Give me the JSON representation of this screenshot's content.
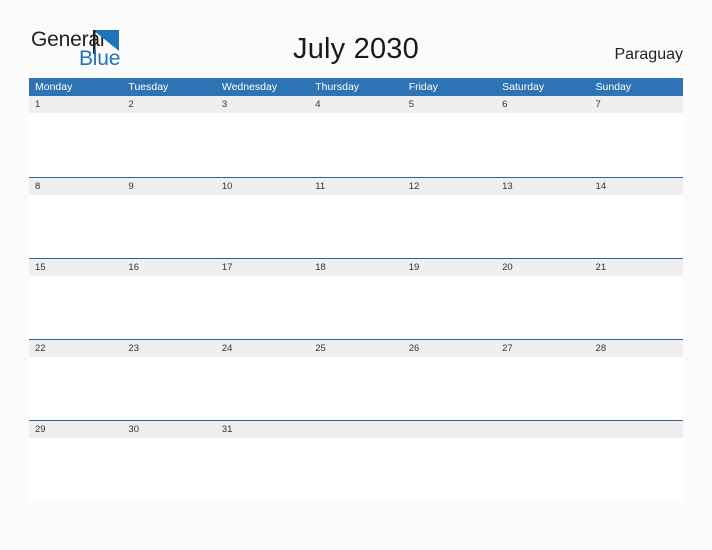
{
  "brand": {
    "name_part1": "General",
    "name_part2": "Blue",
    "flag_icon": "triangle-flag-icon",
    "accent_color": "#1c75bc"
  },
  "header": {
    "title": "July 2030",
    "country": "Paraguay"
  },
  "theme": {
    "header_blue": "#2e74b5",
    "row_divider_blue": "#2e6196",
    "day_band_gray": "#efefef",
    "page_background": "#fbfbfb",
    "title_color": "#1a1a1a"
  },
  "calendar": {
    "month": "July",
    "year": "2030",
    "week_start": "Monday",
    "weekdays": [
      "Monday",
      "Tuesday",
      "Wednesday",
      "Thursday",
      "Friday",
      "Saturday",
      "Sunday"
    ],
    "weeks": [
      [
        "1",
        "2",
        "3",
        "4",
        "5",
        "6",
        "7"
      ],
      [
        "8",
        "9",
        "10",
        "11",
        "12",
        "13",
        "14"
      ],
      [
        "15",
        "16",
        "17",
        "18",
        "19",
        "20",
        "21"
      ],
      [
        "22",
        "23",
        "24",
        "25",
        "26",
        "27",
        "28"
      ],
      [
        "29",
        "30",
        "31",
        "",
        "",
        "",
        ""
      ]
    ]
  }
}
